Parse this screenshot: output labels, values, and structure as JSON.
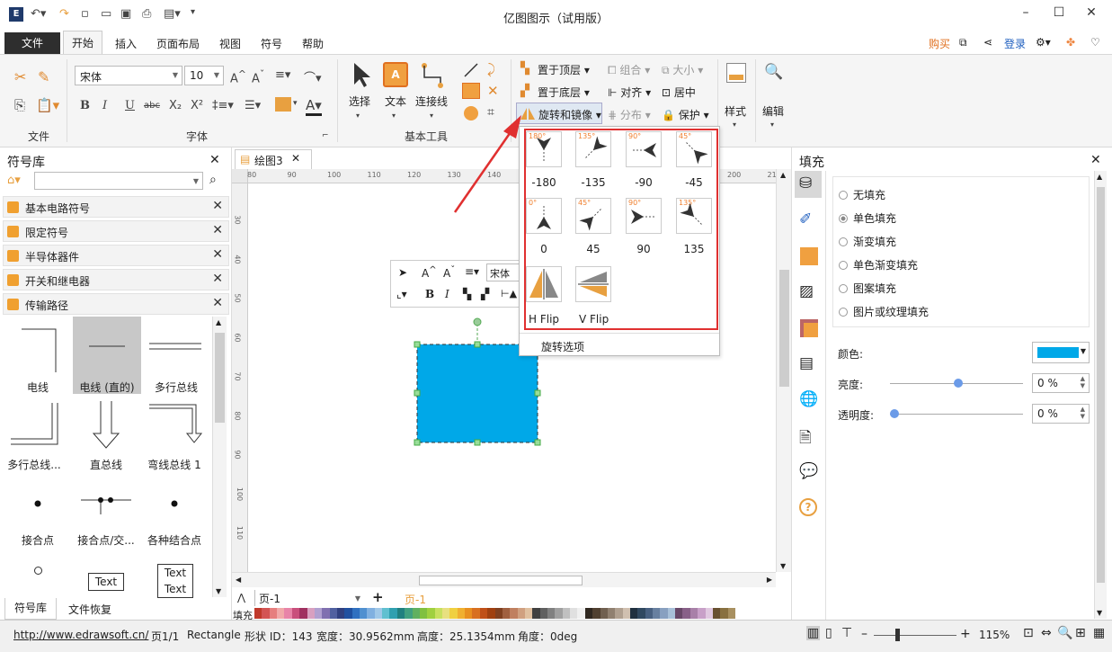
{
  "app_title": "亿图图示（试用版）",
  "menu": {
    "file": "文件",
    "tabs": [
      "开始",
      "插入",
      "页面布局",
      "视图",
      "符号",
      "帮助"
    ],
    "right": {
      "buy": "购买",
      "login": "登录"
    }
  },
  "ribbon": {
    "groups": {
      "file": "文件",
      "font": "字体",
      "basic_tools": "基本工具"
    },
    "font_name": "宋体",
    "font_size": "10",
    "tools": {
      "select": "选择",
      "text": "文本",
      "connector": "连接线",
      "style": "样式",
      "edit": "编辑"
    },
    "arrange": {
      "bring_front": "置于顶层",
      "send_back": "置于底层",
      "rotate_mirror": "旋转和镜像",
      "group": "组合",
      "align": "对齐",
      "distribute": "分布",
      "size": "大小",
      "center": "居中",
      "protect": "保护"
    }
  },
  "left_panel": {
    "title": "符号库",
    "categories": [
      "基本电路符号",
      "限定符号",
      "半导体器件",
      "开关和继电器",
      "传输路径"
    ],
    "symbols": [
      "电线",
      "电线 (直的)",
      "多行总线",
      "多行总线...",
      "直总线",
      "弯线总线 1",
      "接合点",
      "接合点/交...",
      "各种结合点"
    ],
    "text_sym": "Text",
    "bottom_tabs": [
      "符号库",
      "文件恢复"
    ]
  },
  "canvas": {
    "doc_tab": "绘图3",
    "hruler": [
      "80",
      "90",
      "100",
      "110",
      "120",
      "130",
      "140",
      "150",
      "160",
      "170",
      "180",
      "190",
      "200",
      "210"
    ],
    "vruler": [
      "30",
      "40",
      "50",
      "60",
      "70",
      "80",
      "90",
      "100",
      "110"
    ],
    "page_tab": "页-1",
    "page_tab_active": "页-1",
    "fill_label": "填充",
    "mini_font": "宋体"
  },
  "popup": {
    "rotations": [
      {
        "deg": "180°",
        "label": "-180"
      },
      {
        "deg": "135°",
        "label": "-135"
      },
      {
        "deg": "90°",
        "label": "-90"
      },
      {
        "deg": "45°",
        "label": "-45"
      },
      {
        "deg": "0°",
        "label": "0"
      },
      {
        "deg": "45°",
        "label": "45"
      },
      {
        "deg": "90°",
        "label": "90"
      },
      {
        "deg": "135°",
        "label": "135"
      }
    ],
    "flips": [
      "H Flip",
      "V Flip"
    ],
    "options": "旋转选项"
  },
  "right_panel": {
    "title": "填充",
    "options": [
      "无填充",
      "单色填充",
      "渐变填充",
      "单色渐变填充",
      "图案填充",
      "图片或纹理填充"
    ],
    "selected": "单色填充",
    "color_label": "颜色:",
    "brightness_label": "亮度:",
    "transparency_label": "透明度:",
    "brightness": "0 %",
    "transparency": "0 %",
    "fill_color": "#00a8e8"
  },
  "status": {
    "url": "http://www.edrawsoft.cn/",
    "page": "页1/1",
    "shape": "Rectangle",
    "shape_id": "形状 ID：143",
    "width": "宽度：30.9562mm",
    "height": "高度：25.1354mm",
    "angle": "角度：0deg",
    "zoom": "115%"
  },
  "colors": {
    "accent": "#f0a030",
    "popup_border": "#e03030",
    "shape": "#00a8e8"
  }
}
